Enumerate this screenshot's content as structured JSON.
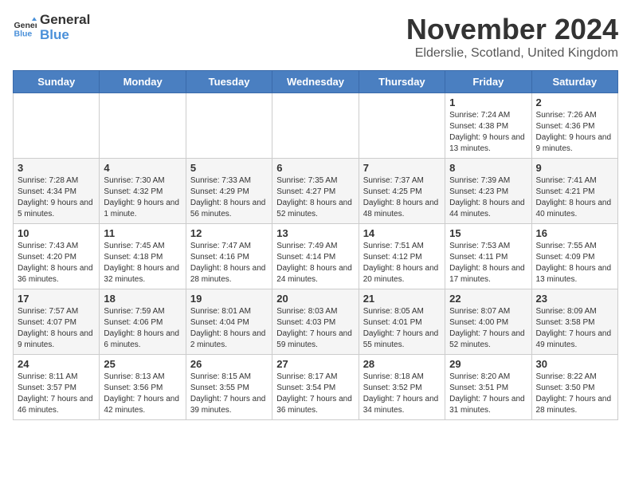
{
  "logo": {
    "general": "General",
    "blue": "Blue"
  },
  "title": "November 2024",
  "location": "Elderslie, Scotland, United Kingdom",
  "days_of_week": [
    "Sunday",
    "Monday",
    "Tuesday",
    "Wednesday",
    "Thursday",
    "Friday",
    "Saturday"
  ],
  "weeks": [
    [
      {
        "day": "",
        "info": ""
      },
      {
        "day": "",
        "info": ""
      },
      {
        "day": "",
        "info": ""
      },
      {
        "day": "",
        "info": ""
      },
      {
        "day": "",
        "info": ""
      },
      {
        "day": "1",
        "info": "Sunrise: 7:24 AM\nSunset: 4:38 PM\nDaylight: 9 hours and 13 minutes."
      },
      {
        "day": "2",
        "info": "Sunrise: 7:26 AM\nSunset: 4:36 PM\nDaylight: 9 hours and 9 minutes."
      }
    ],
    [
      {
        "day": "3",
        "info": "Sunrise: 7:28 AM\nSunset: 4:34 PM\nDaylight: 9 hours and 5 minutes."
      },
      {
        "day": "4",
        "info": "Sunrise: 7:30 AM\nSunset: 4:32 PM\nDaylight: 9 hours and 1 minute."
      },
      {
        "day": "5",
        "info": "Sunrise: 7:33 AM\nSunset: 4:29 PM\nDaylight: 8 hours and 56 minutes."
      },
      {
        "day": "6",
        "info": "Sunrise: 7:35 AM\nSunset: 4:27 PM\nDaylight: 8 hours and 52 minutes."
      },
      {
        "day": "7",
        "info": "Sunrise: 7:37 AM\nSunset: 4:25 PM\nDaylight: 8 hours and 48 minutes."
      },
      {
        "day": "8",
        "info": "Sunrise: 7:39 AM\nSunset: 4:23 PM\nDaylight: 8 hours and 44 minutes."
      },
      {
        "day": "9",
        "info": "Sunrise: 7:41 AM\nSunset: 4:21 PM\nDaylight: 8 hours and 40 minutes."
      }
    ],
    [
      {
        "day": "10",
        "info": "Sunrise: 7:43 AM\nSunset: 4:20 PM\nDaylight: 8 hours and 36 minutes."
      },
      {
        "day": "11",
        "info": "Sunrise: 7:45 AM\nSunset: 4:18 PM\nDaylight: 8 hours and 32 minutes."
      },
      {
        "day": "12",
        "info": "Sunrise: 7:47 AM\nSunset: 4:16 PM\nDaylight: 8 hours and 28 minutes."
      },
      {
        "day": "13",
        "info": "Sunrise: 7:49 AM\nSunset: 4:14 PM\nDaylight: 8 hours and 24 minutes."
      },
      {
        "day": "14",
        "info": "Sunrise: 7:51 AM\nSunset: 4:12 PM\nDaylight: 8 hours and 20 minutes."
      },
      {
        "day": "15",
        "info": "Sunrise: 7:53 AM\nSunset: 4:11 PM\nDaylight: 8 hours and 17 minutes."
      },
      {
        "day": "16",
        "info": "Sunrise: 7:55 AM\nSunset: 4:09 PM\nDaylight: 8 hours and 13 minutes."
      }
    ],
    [
      {
        "day": "17",
        "info": "Sunrise: 7:57 AM\nSunset: 4:07 PM\nDaylight: 8 hours and 9 minutes."
      },
      {
        "day": "18",
        "info": "Sunrise: 7:59 AM\nSunset: 4:06 PM\nDaylight: 8 hours and 6 minutes."
      },
      {
        "day": "19",
        "info": "Sunrise: 8:01 AM\nSunset: 4:04 PM\nDaylight: 8 hours and 2 minutes."
      },
      {
        "day": "20",
        "info": "Sunrise: 8:03 AM\nSunset: 4:03 PM\nDaylight: 7 hours and 59 minutes."
      },
      {
        "day": "21",
        "info": "Sunrise: 8:05 AM\nSunset: 4:01 PM\nDaylight: 7 hours and 55 minutes."
      },
      {
        "day": "22",
        "info": "Sunrise: 8:07 AM\nSunset: 4:00 PM\nDaylight: 7 hours and 52 minutes."
      },
      {
        "day": "23",
        "info": "Sunrise: 8:09 AM\nSunset: 3:58 PM\nDaylight: 7 hours and 49 minutes."
      }
    ],
    [
      {
        "day": "24",
        "info": "Sunrise: 8:11 AM\nSunset: 3:57 PM\nDaylight: 7 hours and 46 minutes."
      },
      {
        "day": "25",
        "info": "Sunrise: 8:13 AM\nSunset: 3:56 PM\nDaylight: 7 hours and 42 minutes."
      },
      {
        "day": "26",
        "info": "Sunrise: 8:15 AM\nSunset: 3:55 PM\nDaylight: 7 hours and 39 minutes."
      },
      {
        "day": "27",
        "info": "Sunrise: 8:17 AM\nSunset: 3:54 PM\nDaylight: 7 hours and 36 minutes."
      },
      {
        "day": "28",
        "info": "Sunrise: 8:18 AM\nSunset: 3:52 PM\nDaylight: 7 hours and 34 minutes."
      },
      {
        "day": "29",
        "info": "Sunrise: 8:20 AM\nSunset: 3:51 PM\nDaylight: 7 hours and 31 minutes."
      },
      {
        "day": "30",
        "info": "Sunrise: 8:22 AM\nSunset: 3:50 PM\nDaylight: 7 hours and 28 minutes."
      }
    ]
  ]
}
